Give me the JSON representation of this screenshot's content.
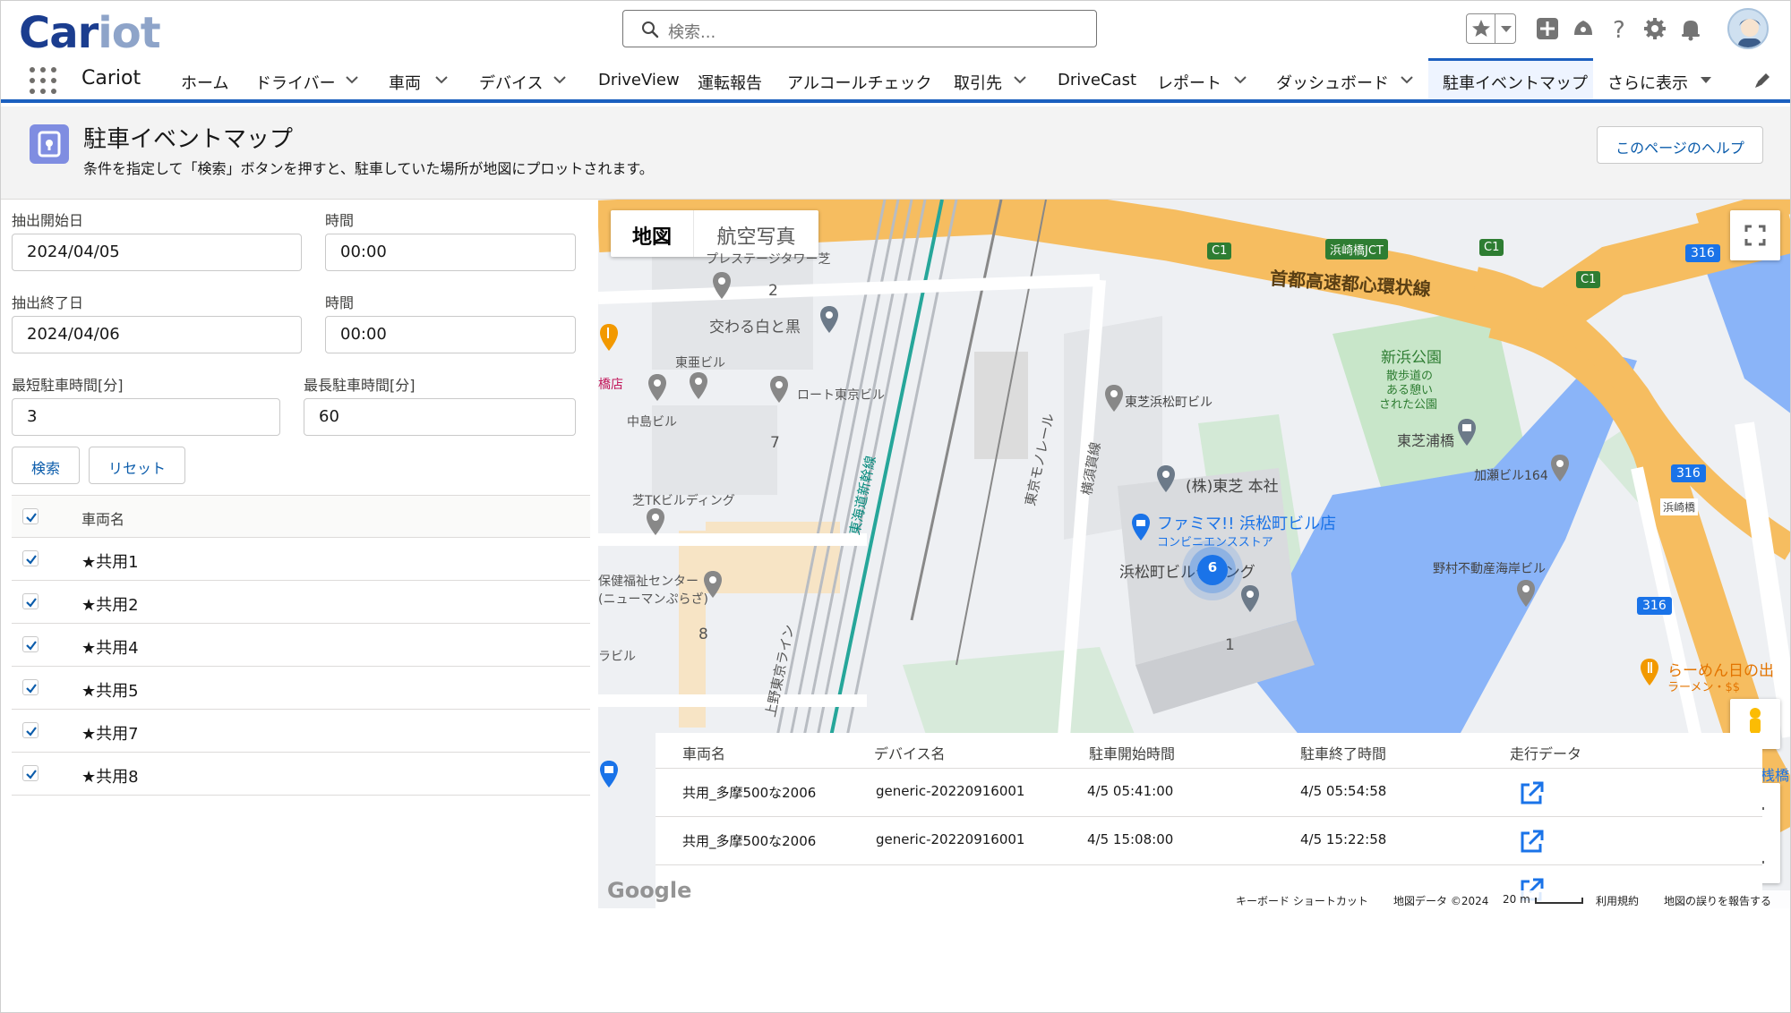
{
  "header": {
    "logo_main": "Car",
    "logo_accent": "iot",
    "search_placeholder": "検索..."
  },
  "nav": {
    "app_name": "Cariot",
    "items": [
      "ホーム",
      "ドライバー",
      "車両",
      "デバイス",
      "DriveView",
      "運転報告",
      "アルコールチェック",
      "取引先",
      "DriveCast",
      "レポート",
      "ダッシュボード",
      "駐車イベントマップ",
      "さらに表示"
    ],
    "active": "駐車イベントマップ"
  },
  "page": {
    "title": "駐車イベントマップ",
    "subtitle": "条件を指定して「検索」ボタンを押すと、駐車していた場所が地図にプロットされます。",
    "help_button": "このページのヘルプ"
  },
  "form": {
    "start_date_label": "抽出開始日",
    "start_date": "2024/04/05",
    "start_time_label": "時間",
    "start_time": "00:00",
    "end_date_label": "抽出終了日",
    "end_date": "2024/04/06",
    "end_time_label": "時間",
    "end_time": "00:00",
    "min_park_label": "最短駐車時間[分]",
    "min_park": "3",
    "max_park_label": "最長駐車時間[分]",
    "max_park": "60",
    "search_button": "検索",
    "reset_button": "リセット"
  },
  "vehicles": {
    "header": "車両名",
    "rows": [
      "★共用1",
      "★共用2",
      "★共用4",
      "★共用5",
      "★共用7",
      "★共用8"
    ]
  },
  "map": {
    "toggle_map": "地図",
    "toggle_satellite": "航空写真",
    "cluster_count": "6",
    "labels": {
      "expressway": "首都高速都心環状線",
      "jct": "浜崎橋JCT",
      "c1": "C1",
      "r316": "316",
      "toshiba_hq": "(株)東芝 本社",
      "toshiba_bldg": "東芝浜松町ビル",
      "familymart": "ファミマ!! 浜松町ビル店",
      "familymart_sub": "コンビニエンスストア",
      "hamamatsucho_bldg": "浜松町ビルディング",
      "kawaru": "交わる白と黒",
      "touabldg": "東亜ビル",
      "nakajima": "中島ビル",
      "roto": "ロート東京ビル",
      "shiba_tk": "芝TKビルディング",
      "hoken1": "保健福祉センター",
      "hoken2": "(ニューマンぷらざ)",
      "prestige": "プレステージタワー芝",
      "shinhama1": "新浜公園",
      "shinhama2": "散歩道の",
      "shinhama3": "ある憩い",
      "shinhama4": "された公園",
      "toshiba_ura": "東芝浦橋",
      "kasetsu": "加瀬ビル164",
      "hamazakibashi": "浜崎橋",
      "nomura": "野村不動産海岸ビル",
      "ramen": "らーめん日の出",
      "ramen_sub": "ラーメン・$$",
      "monorail": "東京モノレール",
      "shinkansen": "東海道新幹線",
      "yokosuka": "横須賀線",
      "ueno_tokyo": "上野東京ライン",
      "sanbashi": "の出桟橋",
      "left_edge1": "橋店",
      "left_edge2": "ラビル",
      "n2": "2",
      "n7": "7",
      "n8": "8",
      "n1": "1"
    },
    "attribution": {
      "keyboard": "キーボード ショートカット",
      "mapdata": "地図データ ©2024",
      "scale": "20 m",
      "terms": "利用規約",
      "report": "地図の誤りを報告する",
      "google": "Google"
    }
  },
  "parking_table": {
    "columns": [
      "車両名",
      "デバイス名",
      "駐車開始時間",
      "駐車終了時間",
      "走行データ"
    ],
    "rows": [
      {
        "vehicle": "共用_多摩500な2006",
        "device": "generic-20220916001",
        "start": "4/5 05:41:00",
        "end": "4/5 05:54:58"
      },
      {
        "vehicle": "共用_多摩500な2006",
        "device": "generic-20220916001",
        "start": "4/5 15:08:00",
        "end": "4/5 15:22:58"
      }
    ]
  },
  "colors": {
    "brand_blue": "#1b3d8f",
    "accent": "#0b5cab",
    "expressway": "#f6bd60",
    "water": "#8ab4f8",
    "park": "#c8e6c9",
    "cluster": "#1a73e8"
  }
}
